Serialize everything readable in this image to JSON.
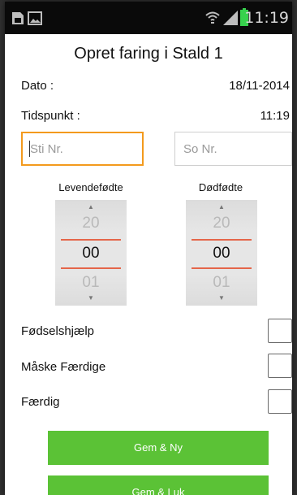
{
  "status_bar": {
    "time": "11:19",
    "icons": [
      "sim-icon",
      "image-icon",
      "wifi-icon",
      "signal-icon",
      "battery-icon"
    ],
    "battery_color": "#37d24d"
  },
  "form": {
    "title": "Opret faring i Stald 1",
    "date_label": "Dato :",
    "date_value": "18/11-2014",
    "time_label": "Tidspunkt :",
    "time_value": "11:19",
    "sti_placeholder": "Sti Nr.",
    "so_placeholder": "So Nr."
  },
  "pickers": {
    "live": {
      "label": "Levendefødte",
      "prev": "20",
      "value": "00",
      "next": "01"
    },
    "dead": {
      "label": "Dødfødte",
      "prev": "20",
      "value": "00",
      "next": "01"
    }
  },
  "checks": {
    "fodsel": {
      "label": "Fødselshjælp",
      "checked": false
    },
    "maske": {
      "label": "Måske Færdige",
      "checked": false
    },
    "faerdig": {
      "label": "Færdig",
      "checked": false
    }
  },
  "buttons": {
    "gem_ny": "Gem & Ny",
    "gem_luk": "Gem & Luk"
  },
  "colors": {
    "accent": "#5bc236",
    "focus": "#f39a1d",
    "picker_line": "#e5664a"
  }
}
